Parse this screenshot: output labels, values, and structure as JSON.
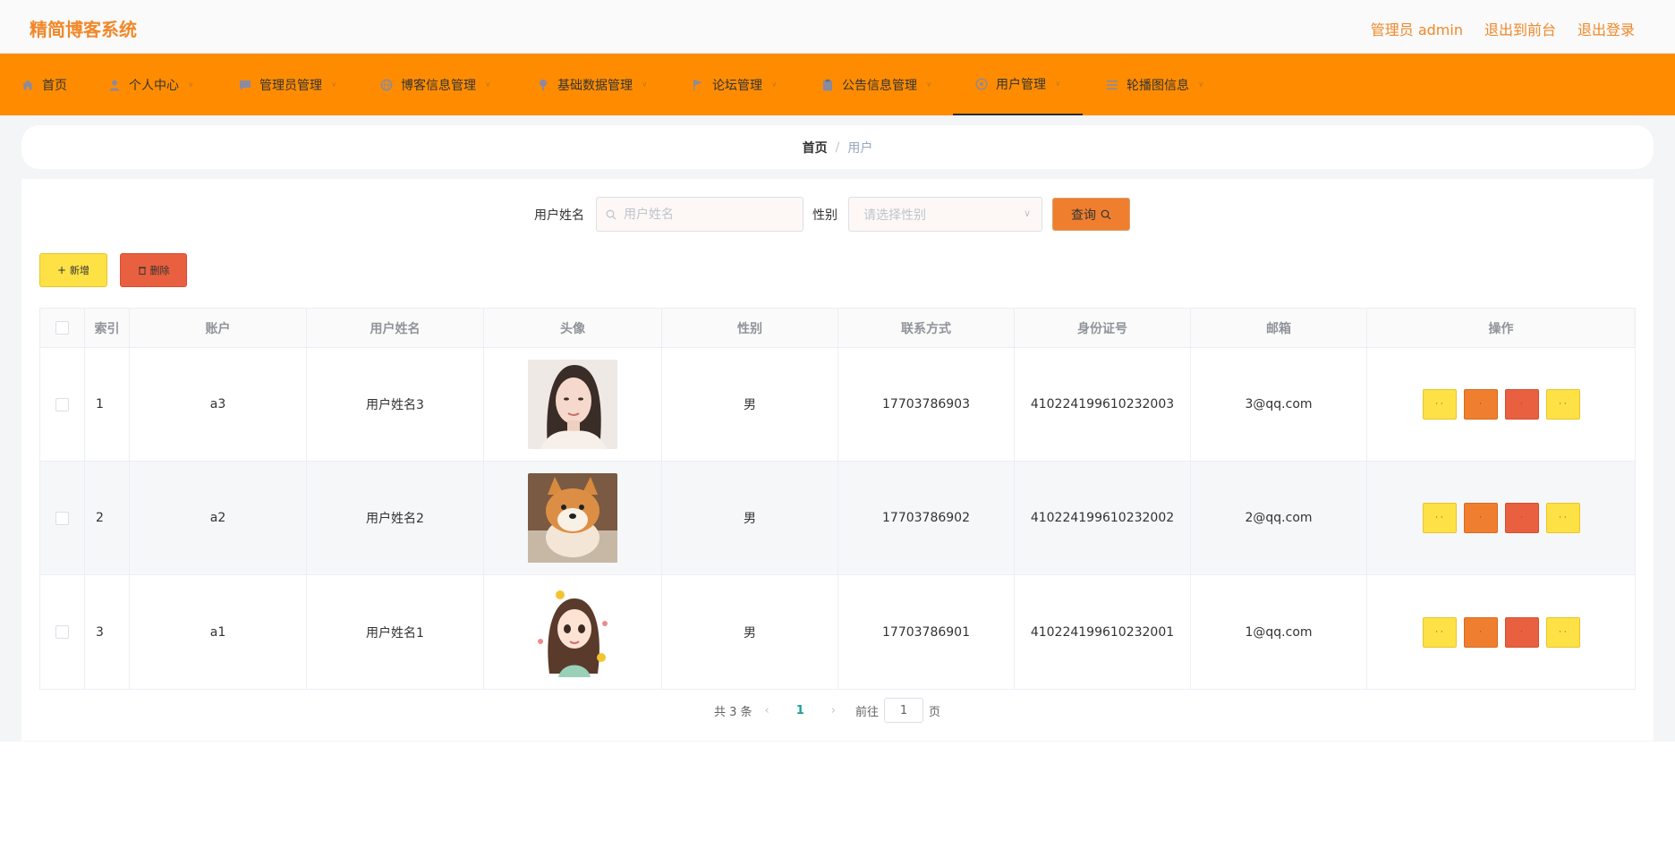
{
  "app": {
    "brand": "精简博客系统",
    "header_links": [
      "管理员 admin",
      "退出到前台",
      "退出登录"
    ]
  },
  "nav": {
    "items": [
      {
        "label": "首页",
        "icon": "home-icon"
      },
      {
        "label": "个人中心",
        "icon": "user-icon"
      },
      {
        "label": "管理员管理",
        "icon": "chat-icon"
      },
      {
        "label": "博客信息管理",
        "icon": "globe-icon"
      },
      {
        "label": "基础数据管理",
        "icon": "pin-icon"
      },
      {
        "label": "论坛管理",
        "icon": "flag-icon"
      },
      {
        "label": "公告信息管理",
        "icon": "clipboard-icon"
      },
      {
        "label": "用户管理",
        "icon": "target-icon"
      },
      {
        "label": "轮播图信息",
        "icon": "list-icon"
      }
    ],
    "active_index": 7
  },
  "breadcrumb": {
    "home": "首页",
    "separator": "/",
    "current": "用户"
  },
  "search": {
    "name_label": "用户姓名",
    "name_placeholder": "用户姓名",
    "gender_label": "性别",
    "gender_placeholder": "请选择性别",
    "query_button": "查询"
  },
  "actions": {
    "add_label": "新增",
    "delete_label": "删除"
  },
  "table": {
    "columns": [
      "索引",
      "账户",
      "用户姓名",
      "头像",
      "性别",
      "联系方式",
      "身份证号",
      "邮箱",
      "操作"
    ],
    "rows": [
      {
        "index": "1",
        "account": "a3",
        "name": "用户姓名3",
        "avatar": "woman-portrait",
        "gender": "男",
        "phone": "17703786903",
        "id_card": "410224199610232003",
        "email": "3@qq.com"
      },
      {
        "index": "2",
        "account": "a2",
        "name": "用户姓名2",
        "avatar": "shiba-dog",
        "gender": "男",
        "phone": "17703786902",
        "id_card": "410224199610232002",
        "email": "2@qq.com"
      },
      {
        "index": "3",
        "account": "a1",
        "name": "用户姓名1",
        "avatar": "cartoon-girl",
        "gender": "男",
        "phone": "17703786901",
        "id_card": "410224199610232001",
        "email": "1@qq.com"
      }
    ],
    "op_buttons": [
      {
        "label": "· ·",
        "color": "yellow"
      },
      {
        "label": "·",
        "color": "orange"
      },
      {
        "label": "·",
        "color": "red"
      },
      {
        "label": "· ·",
        "color": "yellow"
      }
    ]
  },
  "pagination": {
    "total_text": "共 3 条",
    "current_page": "1",
    "goto_label": "前往",
    "goto_value": "1",
    "page_suffix": "页"
  },
  "colors": {
    "brand": "#f0882a",
    "nav_bg": "#ff8c00",
    "yellow_button": "#fde145",
    "orange_button": "#ef7f2f",
    "red_button": "#e8603f",
    "active_page": "#1aa094"
  }
}
